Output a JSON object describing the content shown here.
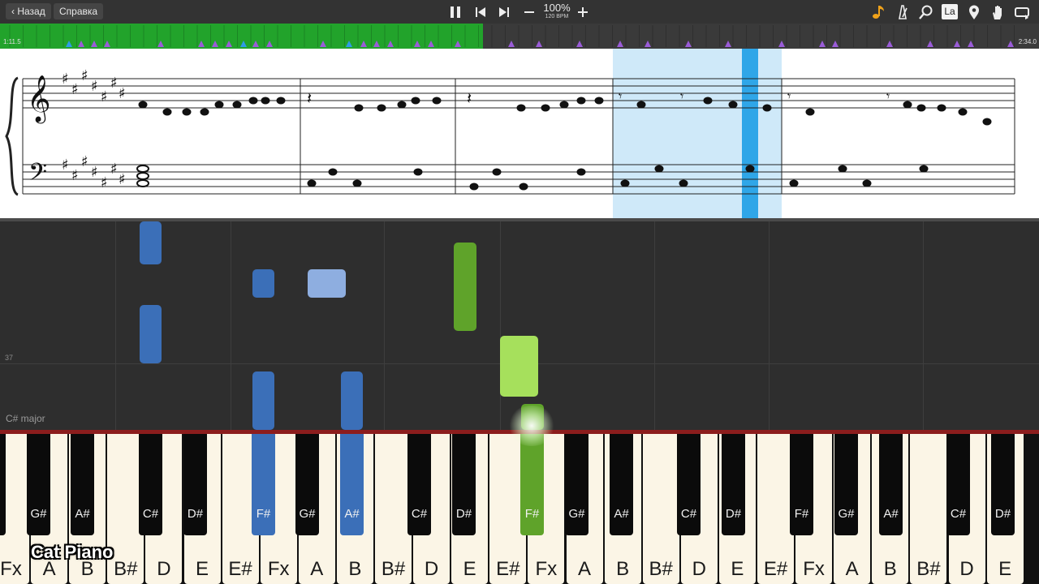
{
  "toolbar": {
    "back_label": "Назад",
    "help_label": "Справка",
    "zoom": "100%",
    "bpm": "120 BPM",
    "note_name_button": "La"
  },
  "timeline": {
    "current_time": "1:11.5",
    "total_time": "2:34.0",
    "progress_fraction": 0.465
  },
  "sheet": {
    "highlight_color": "#cfe9f9",
    "playhead_color": "#2fa6e8"
  },
  "roll": {
    "measure_number": "37",
    "key_signature": "C# major"
  },
  "keyboard": {
    "white_keys": [
      "Fx",
      "A",
      "B",
      "B#",
      "D",
      "E",
      "E#",
      "Fx",
      "A",
      "B",
      "B#",
      "D",
      "E",
      "E#",
      "Fx",
      "A",
      "B",
      "B#",
      "D",
      "E",
      "E#",
      "Fx",
      "A",
      "B",
      "B#",
      "D",
      "E"
    ],
    "black_keys": [
      {
        "label": "G#",
        "state": "normal"
      },
      {
        "label": "A#",
        "state": "normal"
      },
      {
        "label": "C#",
        "state": "normal"
      },
      {
        "label": "D#",
        "state": "normal"
      },
      {
        "label": "F#",
        "state": "blue"
      },
      {
        "label": "G#",
        "state": "normal"
      },
      {
        "label": "A#",
        "state": "blue"
      },
      {
        "label": "C#",
        "state": "normal"
      },
      {
        "label": "D#",
        "state": "normal"
      },
      {
        "label": "F#",
        "state": "green"
      },
      {
        "label": "G#",
        "state": "normal"
      },
      {
        "label": "A#",
        "state": "normal"
      },
      {
        "label": "C#",
        "state": "normal"
      },
      {
        "label": "D#",
        "state": "normal"
      },
      {
        "label": "F#",
        "state": "normal"
      },
      {
        "label": "G#",
        "state": "normal"
      },
      {
        "label": "A#",
        "state": "normal"
      },
      {
        "label": "C#",
        "state": "normal"
      },
      {
        "label": "D#",
        "state": "normal"
      }
    ]
  },
  "colors": {
    "left_hand": "#3b6fb8",
    "left_hand_light": "#8eaee0",
    "right_hand": "#5fa32a",
    "right_hand_light": "#a6e05c",
    "progress": "#22a32b"
  },
  "brand": "Cat Piano"
}
